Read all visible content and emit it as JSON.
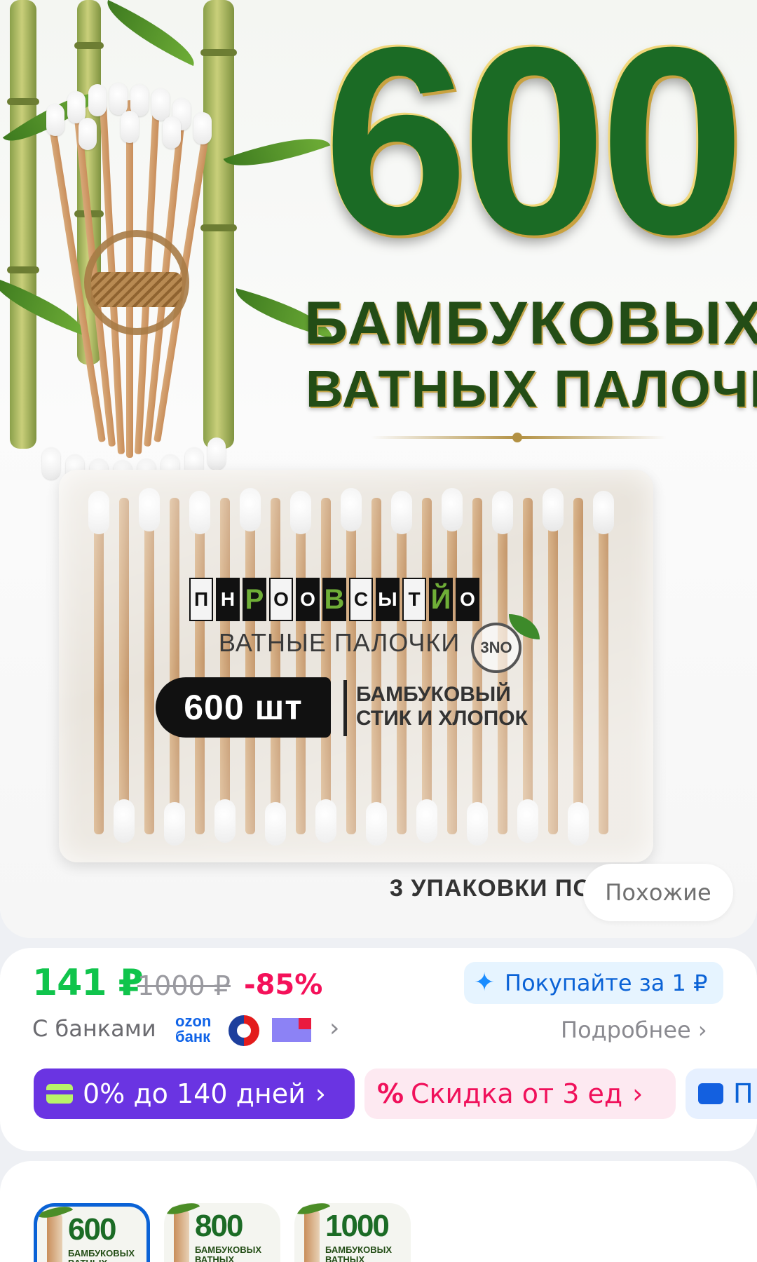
{
  "product_image": {
    "big_number": "600",
    "headline_line1": "БАМБУКОВЫХ",
    "headline_line2": "ВАТНЫХ ПАЛОЧЕК",
    "brand_letters": [
      "П",
      "Н",
      "Р",
      "О",
      "О",
      "В",
      "С",
      "Ы",
      "Т",
      "Й",
      "О"
    ],
    "pack_title": "ВАТНЫЕ ПАЛОЧКИ",
    "eco_badge": "3NO",
    "count": "600 шт",
    "pack_subtitle": "БАМБУКОВЫЙ\nСТИК И ХЛОПОК",
    "caption": "3 УПАКОВКИ ПО"
  },
  "similar_button": "Похожие",
  "price": {
    "current": "141 ₽",
    "old": "1000 ₽",
    "discount": "-85%",
    "buy_for_1": "Покупайте за 1 ₽",
    "with_banks": "С банками",
    "ozon_bank": "ozon\nбанк",
    "details": "Подробнее"
  },
  "chips": {
    "credit": "0% до 140 дней",
    "discount": "Скидка от 3 ед",
    "more": "П"
  },
  "variants": [
    {
      "number": "600",
      "text": "БАМБУКОВЫХ\nВАТНЫХ ПАЛОЧЕК",
      "selected": true
    },
    {
      "number": "800",
      "text": "БАМБУКОВЫХ\nВАТНЫХ ПАЛОЧЕК",
      "selected": false
    },
    {
      "number": "1000",
      "text": "БАМБУКОВЫХ\nВАТНЫХ ПАЛОЧЕК",
      "selected": false
    }
  ],
  "colors": {
    "price_green": "#10c44c",
    "discount_red": "#f4115a",
    "accent_blue": "#0a62d6",
    "credit_purple": "#6a34e2"
  }
}
